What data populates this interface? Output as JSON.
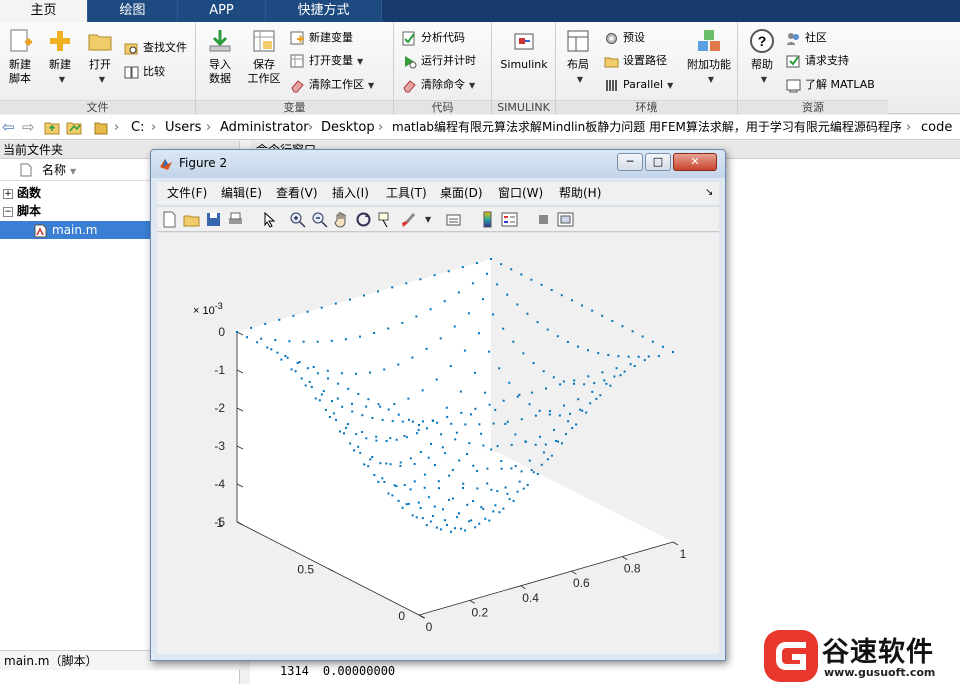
{
  "tabs": [
    "主页",
    "绘图",
    "APP",
    "快捷方式"
  ],
  "ribbon": {
    "file": {
      "label": "文件",
      "new_script": [
        "新建",
        "脚本"
      ],
      "new": "新建",
      "open": "打开",
      "find_files": "查找文件",
      "compare": "比较"
    },
    "variable": {
      "label": "变量",
      "import": [
        "导入",
        "数据"
      ],
      "save_ws": [
        "保存",
        "工作区"
      ],
      "new_var": "新建变量",
      "open_var": "打开变量",
      "clear_ws": "清除工作区"
    },
    "code": {
      "label": "代码",
      "analyze": "分析代码",
      "run_time": "运行并计时",
      "clear_cmd": "清除命令"
    },
    "simulink": {
      "label": "SIMULINK",
      "btn": "Simulink"
    },
    "env": {
      "label": "环境",
      "layout": "布局",
      "prefs": "预设",
      "set_path": "设置路径",
      "parallel": "Parallel",
      "addons": "附加功能"
    },
    "resources": {
      "label": "资源",
      "help": "帮助",
      "community": "社区",
      "support": "请求支持",
      "learn": "了解 MATLAB"
    }
  },
  "address": [
    "C:",
    "Users",
    "Administrator",
    "Desktop",
    "matlab编程有限元算法求解Mindlin板静力问题 用FEM算法求解，用于学习有限元编程源码程序",
    "code"
  ],
  "current_folder": {
    "title": "当前文件夹",
    "col_name": "名称",
    "items": [
      {
        "label": "函数"
      },
      {
        "label": "脚本"
      },
      {
        "label": "main.m"
      }
    ],
    "status": "main.m（脚本）"
  },
  "command_window": {
    "title": "命令行窗口",
    "last_line": {
      "index": "1314",
      "value": "0.00000000"
    }
  },
  "figure": {
    "title": "Figure 2",
    "menus": [
      "文件(F)",
      "编辑(E)",
      "查看(V)",
      "插入(I)",
      "工具(T)",
      "桌面(D)",
      "窗口(W)",
      "帮助(H)"
    ],
    "window_buttons": [
      "─",
      "□",
      "✕"
    ]
  },
  "chart_data": {
    "type": "scatter",
    "title": "",
    "xlabel": "",
    "ylabel": "",
    "zlabel": "",
    "exponent_label": "× 10^-3",
    "x_ticks": [
      "0",
      "0.2",
      "0.4",
      "0.6",
      "0.8",
      "1"
    ],
    "y_ticks": [
      "0",
      "0.5",
      "1"
    ],
    "z_ticks": [
      "0",
      "-1",
      "-2",
      "-3",
      "-4",
      "-5"
    ],
    "xlim": [
      0,
      1
    ],
    "ylim": [
      0,
      1
    ],
    "zlim": [
      -5,
      0
    ],
    "series": [
      {
        "grid_n": 19,
        "z_min": -4.9,
        "z_max": 0,
        "shape": "z = -4.9 * sin(pi*x) * sin(pi*y)"
      }
    ],
    "marker_color": "#0072bd",
    "grid": false
  },
  "watermark": {
    "brand": "谷速软件",
    "url": "www.gusuoft.com"
  }
}
